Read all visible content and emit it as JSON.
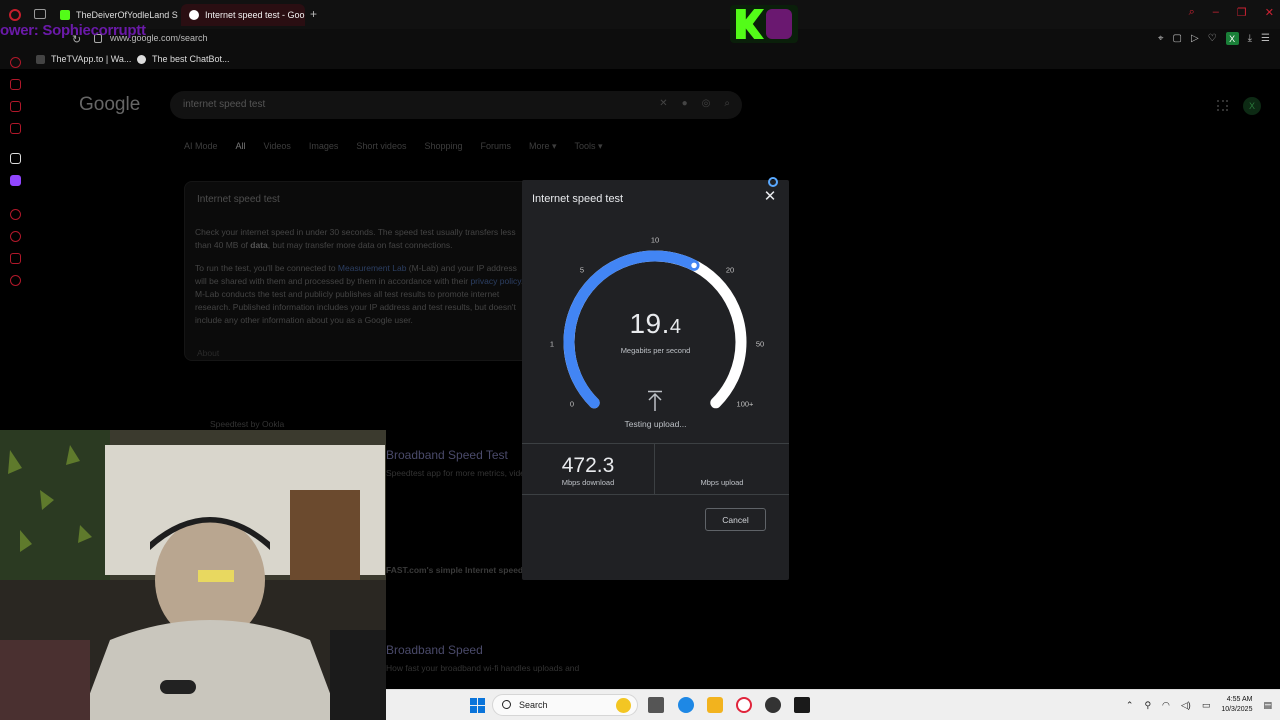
{
  "browser": {
    "tabs": [
      {
        "title": "TheDeiverOfYodleLand S",
        "active": false,
        "favicon_color": "#53fc18"
      },
      {
        "title": "Internet speed test - Goo",
        "active": true,
        "favicon_color": "#ffffff"
      }
    ],
    "new_tab": "+",
    "address": "www.google.com/search",
    "overlay_name": "ower: Sophiecorruptt",
    "bookmarks": [
      {
        "label": "TheTVApp.to | Wa..."
      },
      {
        "label": "The best ChatBot..."
      }
    ],
    "extension_label": "X"
  },
  "google": {
    "logo": "Google",
    "query": "internet speed test",
    "tabs": [
      "AI Mode",
      "All",
      "Videos",
      "Images",
      "Short videos",
      "Shopping",
      "Forums",
      "More ▾",
      "Tools ▾"
    ],
    "active_tab": "All",
    "avatar": "X",
    "card": {
      "title": "Internet speed test",
      "para1_lead": "Check your internet speed in under 30 seconds. The speed test usually transfers less than 40 MB of",
      "para1_bold": "data",
      "para1_tail": ", but may transfer more data on fast connections.",
      "para2_a": "To run the test, you'll be connected to ",
      "para2_link1": "Measurement Lab",
      "para2_b": " (M-Lab) and your IP address will be shared with them and processed by them in accordance with their ",
      "para2_link2": "privacy policy",
      "para2_c": ". M-Lab conducts the test and publicly publishes all test results to promote internet research. Published information includes your IP address and test results, but doesn't include any other information about you as a Google user.",
      "about": "About"
    },
    "results": [
      {
        "label": "Speedtest by Ookla"
      },
      {
        "title": "Broadband Speed Test"
      },
      {
        "snippet": "Speedtest app for more metrics, video ..."
      },
      {
        "snippet": "FAST.com's simple Internet speed test ..."
      },
      {
        "title": "Broadband Speed"
      },
      {
        "snippet": "How fast your broadband wi-fi handles uploads and"
      }
    ]
  },
  "dialog": {
    "title": "Internet speed test",
    "close_label": "✕",
    "gauge": {
      "ticks": [
        "0",
        "1",
        "5",
        "10",
        "20",
        "50",
        "100+"
      ],
      "value": 19.4,
      "progress_fraction": 0.6,
      "accent": "#4285f4",
      "track": "#ffffff"
    },
    "speed_int": "19.",
    "speed_dec": "4",
    "speed_unit": "Megabits per second",
    "status": "Testing upload...",
    "download_value": "472.3",
    "download_unit": "Mbps download",
    "upload_unit": "Mbps upload",
    "cancel_label": "Cancel"
  },
  "taskbar": {
    "search_label": "Search",
    "time": "4:55 AM",
    "date": "10/3/2025"
  }
}
